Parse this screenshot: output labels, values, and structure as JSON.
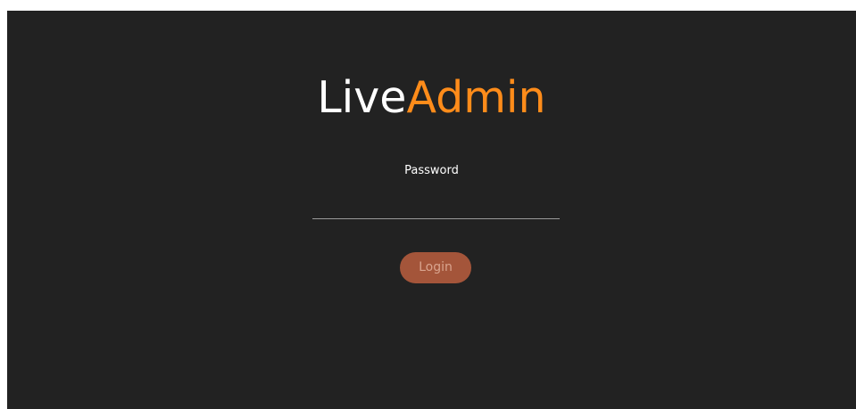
{
  "logo": {
    "part1": "Live",
    "part2": "Admin",
    "colors": {
      "part1": "#ffffff",
      "part2": "#ff8c1a"
    }
  },
  "login_form": {
    "password_label": "Password",
    "password_value": "",
    "login_button_label": "Login",
    "colors": {
      "background": "#222222",
      "button": "#a4553a",
      "button_text": "#d9a48e"
    }
  }
}
